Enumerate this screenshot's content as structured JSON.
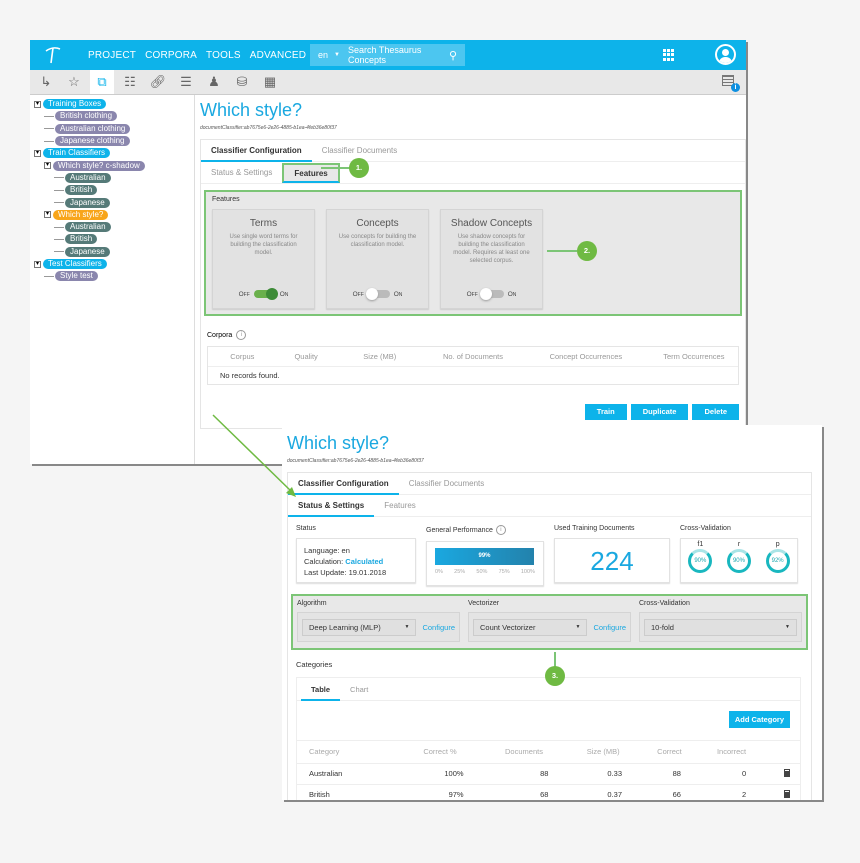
{
  "topbar": {
    "nav": [
      "PROJECT",
      "CORPORA",
      "TOOLS",
      "ADVANCED"
    ],
    "search": {
      "lang": "en",
      "placeholder": "Search Thesaurus Concepts"
    }
  },
  "toolbar": {
    "icons": [
      "hierarchy-icon",
      "starred-document-icon",
      "classifier-icon",
      "org-chart-icon",
      "link-icon",
      "list-icon",
      "user-settings-icon",
      "database-icon",
      "database-user-icon"
    ],
    "active_index": 2
  },
  "tree": [
    {
      "label": "Training Boxes",
      "level": 0,
      "color": "blue",
      "toggle": true
    },
    {
      "label": "British clothing",
      "level": 1,
      "color": "purple"
    },
    {
      "label": "Australian clothing",
      "level": 1,
      "color": "purple"
    },
    {
      "label": "Japanese clothing",
      "level": 1,
      "color": "purple"
    },
    {
      "label": "Train Classifiers",
      "level": 0,
      "color": "blue",
      "toggle": true
    },
    {
      "label": "Which style? c-shadow",
      "level": 1,
      "color": "purple",
      "toggle": true
    },
    {
      "label": "Australian",
      "level": 2,
      "color": "teal"
    },
    {
      "label": "British",
      "level": 2,
      "color": "teal"
    },
    {
      "label": "Japanese",
      "level": 2,
      "color": "teal"
    },
    {
      "label": "Which style?",
      "level": 1,
      "color": "orange",
      "toggle": true
    },
    {
      "label": "Australian",
      "level": 2,
      "color": "teal"
    },
    {
      "label": "British",
      "level": 2,
      "color": "teal"
    },
    {
      "label": "Japanese",
      "level": 2,
      "color": "teal"
    },
    {
      "label": "Test Classifiers",
      "level": 0,
      "color": "blue",
      "toggle": true
    },
    {
      "label": "Style test",
      "level": 1,
      "color": "purple"
    }
  ],
  "page": {
    "title": "Which style?",
    "id": "documentClassifier:ab7675e6-2e26-4885-b1ea-4feb36e80f37",
    "tabs": [
      "Classifier Configuration",
      "Classifier Documents"
    ],
    "subtabs": [
      "Status & Settings",
      "Features"
    ]
  },
  "features": {
    "label": "Features",
    "cards": [
      {
        "title": "Terms",
        "desc": "Use single word terms for building the classification model.",
        "on": true
      },
      {
        "title": "Concepts",
        "desc": "Use concepts for building the classification model.",
        "on": false
      },
      {
        "title": "Shadow Concepts",
        "desc": "Use shadow concepts for building the classification model. Requires at least one selected corpus.",
        "on": false
      }
    ],
    "off_label": "Off",
    "on_label": "On"
  },
  "corpora": {
    "label": "Corpora",
    "columns": [
      "Corpus",
      "Quality",
      "Size (MB)",
      "No. of Documents",
      "Concept Occurrences",
      "Term Occurrences"
    ],
    "empty": "No records found."
  },
  "actions": [
    "Train",
    "Duplicate",
    "Delete"
  ],
  "callouts": [
    "1.",
    "2.",
    "3."
  ],
  "status": {
    "label": "Status",
    "language": "Language: en",
    "calc_prefix": "Calculation: ",
    "calc_value": "Calculated",
    "last_update": "Last Update: 19.01.2018"
  },
  "performance": {
    "label": "General Performance",
    "value_label": "99%",
    "value": 0.99,
    "ticks": [
      "0%",
      "25%",
      "50%",
      "75%",
      "100%"
    ]
  },
  "used_docs": {
    "label": "Used Training Documents",
    "value": "224"
  },
  "cross_validation": {
    "label": "Cross-Validation",
    "rings": [
      {
        "name": "f1",
        "value": "90%"
      },
      {
        "name": "r",
        "value": "90%"
      },
      {
        "name": "p",
        "value": "92%"
      }
    ]
  },
  "settings": {
    "algorithm": {
      "label": "Algorithm",
      "value": "Deep Learning (MLP)",
      "configure": "Configure"
    },
    "vectorizer": {
      "label": "Vectorizer",
      "value": "Count Vectorizer",
      "configure": "Configure"
    },
    "cross_validation": {
      "label": "Cross-Validation",
      "value": "10-fold"
    }
  },
  "categories": {
    "label": "Categories",
    "tabs": [
      "Table",
      "Chart"
    ],
    "add_label": "Add Category",
    "columns": [
      "Category",
      "Correct %",
      "Documents",
      "Size (MB)",
      "Correct",
      "Incorrect"
    ],
    "rows": [
      [
        "Australian",
        "100%",
        "88",
        "0.33",
        "88",
        "0"
      ],
      [
        "British",
        "97%",
        "68",
        "0.37",
        "66",
        "2"
      ]
    ]
  }
}
